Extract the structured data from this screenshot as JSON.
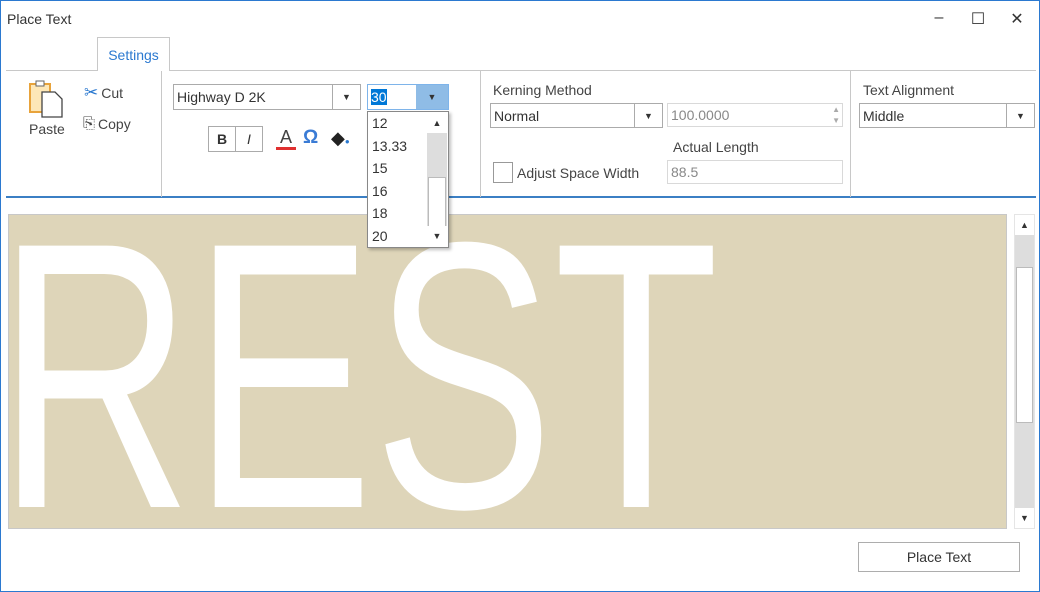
{
  "window": {
    "title": "Place Text",
    "minimize": "–",
    "maximize": "☐",
    "close": "✕"
  },
  "ribbon": {
    "tab": "Settings",
    "clipboard": {
      "paste": "Paste",
      "cut": "Cut",
      "copy": "Copy"
    },
    "font": {
      "name": "Highway D 2K",
      "size": "30",
      "size_options": [
        "12",
        "13.33",
        "15",
        "16",
        "18",
        "20"
      ],
      "bold": "B",
      "italic": "I",
      "color_glyph": "A",
      "symbol_glyph": "Ω"
    },
    "kerning": {
      "label": "Kerning Method",
      "method": "Normal",
      "value": "100.0000",
      "actual_length_label": "Actual Length",
      "actual_length": "88.5",
      "adjust_space_label": "Adjust Space Width"
    },
    "alignment": {
      "label": "Text Alignment",
      "value": "Middle"
    }
  },
  "preview": {
    "text": "REST",
    "background": "#ded5b9"
  },
  "footer": {
    "place_text": "Place Text"
  }
}
